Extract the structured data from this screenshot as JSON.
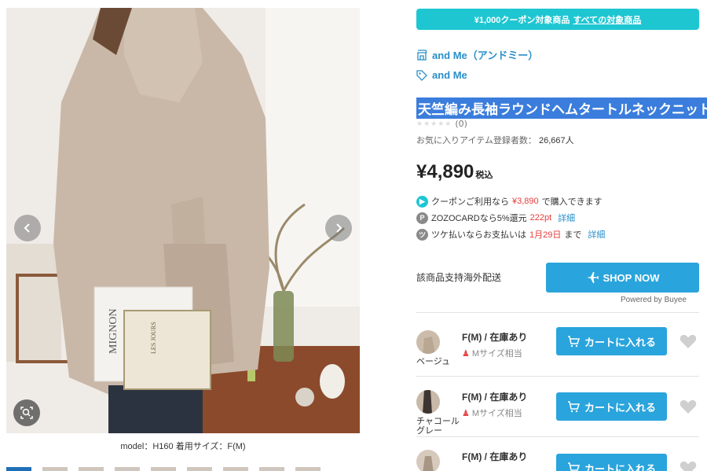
{
  "gallery": {
    "caption": "model：H160 着用サイズ：F(M)",
    "prev_icon": "chevron-left-icon",
    "next_icon": "chevron-right-icon",
    "zoom_icon": "zoom-search-icon",
    "photo_text": {
      "magazine": "MIGNON",
      "book": "LES JOURS"
    }
  },
  "coupon_banner": {
    "text": "¥1,000クーポン対象商品",
    "link": "すべての対象商品",
    "color": "#1ec6d2"
  },
  "shop": {
    "icon": "store-icon",
    "label": "and Me（アンドミー）"
  },
  "brand": {
    "icon": "tag-icon",
    "label": "and Me"
  },
  "product": {
    "title": "天竺編み長袖ラウンドヘムタートルネックニット",
    "rating_count": "(0)",
    "favorites_label": "お気に入りアイテム登録者数：",
    "favorites_count": "26,667人",
    "price": "¥4,890",
    "tax_label": "税込"
  },
  "promos": [
    {
      "icon": "coupon-icon",
      "color": "#1ec6d2",
      "pre": "クーポンご利用なら",
      "highlight": "¥3,890",
      "post": "で購入できます",
      "link": ""
    },
    {
      "icon": "zozocard-icon",
      "color": "#8a8a8a",
      "pre": "ZOZOCARDなら5%還元",
      "highlight": "222pt",
      "post": "",
      "link": "詳細"
    },
    {
      "icon": "tsuke-icon",
      "color": "#8a8a8a",
      "pre": "ツケ払いならお支払いは",
      "highlight": "1月29日",
      "post": "まで",
      "link": "詳細"
    }
  ],
  "overseas": {
    "label": "該商品支持海外配送",
    "button": "SHOP NOW",
    "button_icon": "airplane-icon",
    "powered": "Powered by Buyee"
  },
  "variants": [
    {
      "color": "ベージュ",
      "size": "F(M) / 在庫あり",
      "fit": "Mサイズ相当",
      "button": "カートに入れる"
    },
    {
      "color": "チャコールグレー",
      "size": "F(M) / 在庫あり",
      "fit": "Mサイズ相当",
      "button": "カートに入れる"
    },
    {
      "color": "",
      "size": "F(M) / 在庫あり",
      "fit": "",
      "button": "カートに入れる"
    }
  ],
  "colors": {
    "accent_blue": "#2aa4dc",
    "link_blue": "#2a8fc8",
    "price_red": "#e63b3b",
    "title_highlight": "#3b7ddc"
  }
}
